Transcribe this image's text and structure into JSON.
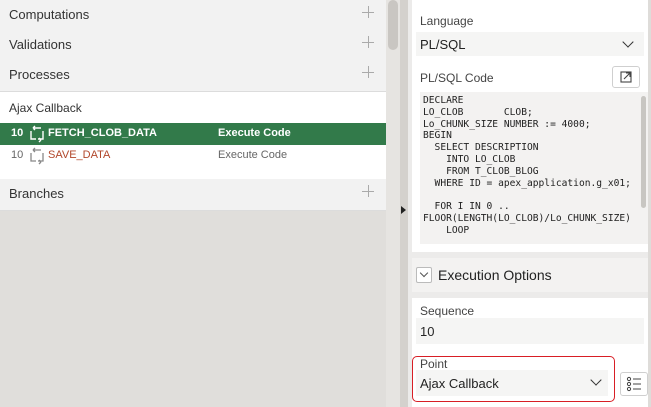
{
  "tree": {
    "sections": {
      "computations": "Computations",
      "validations": "Validations",
      "processes": "Processes",
      "branches": "Branches"
    },
    "process_point": "Ajax Callback",
    "processes": [
      {
        "seq": "10",
        "name": "FETCH_CLOB_DATA",
        "type": "Execute Code"
      },
      {
        "seq": "10",
        "name": "SAVE_DATA",
        "type": "Execute Code"
      }
    ]
  },
  "props": {
    "language_label": "Language",
    "language_value": "PL/SQL",
    "code_label": "PL/SQL Code",
    "code_text": "DECLARE\nLO_CLOB       CLOB;\nLo_CHUNK_SIZE NUMBER := 4000;\nBEGIN\n  SELECT DESCRIPTION\n    INTO LO_CLOB\n    FROM T_CLOB_BLOG\n  WHERE ID = apex_application.g_x01;\n\n  FOR I IN 0 ..\nFLOOR(LENGTH(LO_CLOB)/Lo_CHUNK_SIZE)\n    LOOP",
    "exec_options_title": "Execution Options",
    "sequence_label": "Sequence",
    "sequence_value": "10",
    "point_label": "Point",
    "point_value": "Ajax Callback"
  },
  "colors": {
    "selected_row": "#327a4a",
    "highlight": "#d81e25"
  },
  "icons": [
    "plus-icon",
    "process-code-icon",
    "expand-icon",
    "chevron-down-icon",
    "list-icon",
    "collapse-arrow-icon"
  ]
}
